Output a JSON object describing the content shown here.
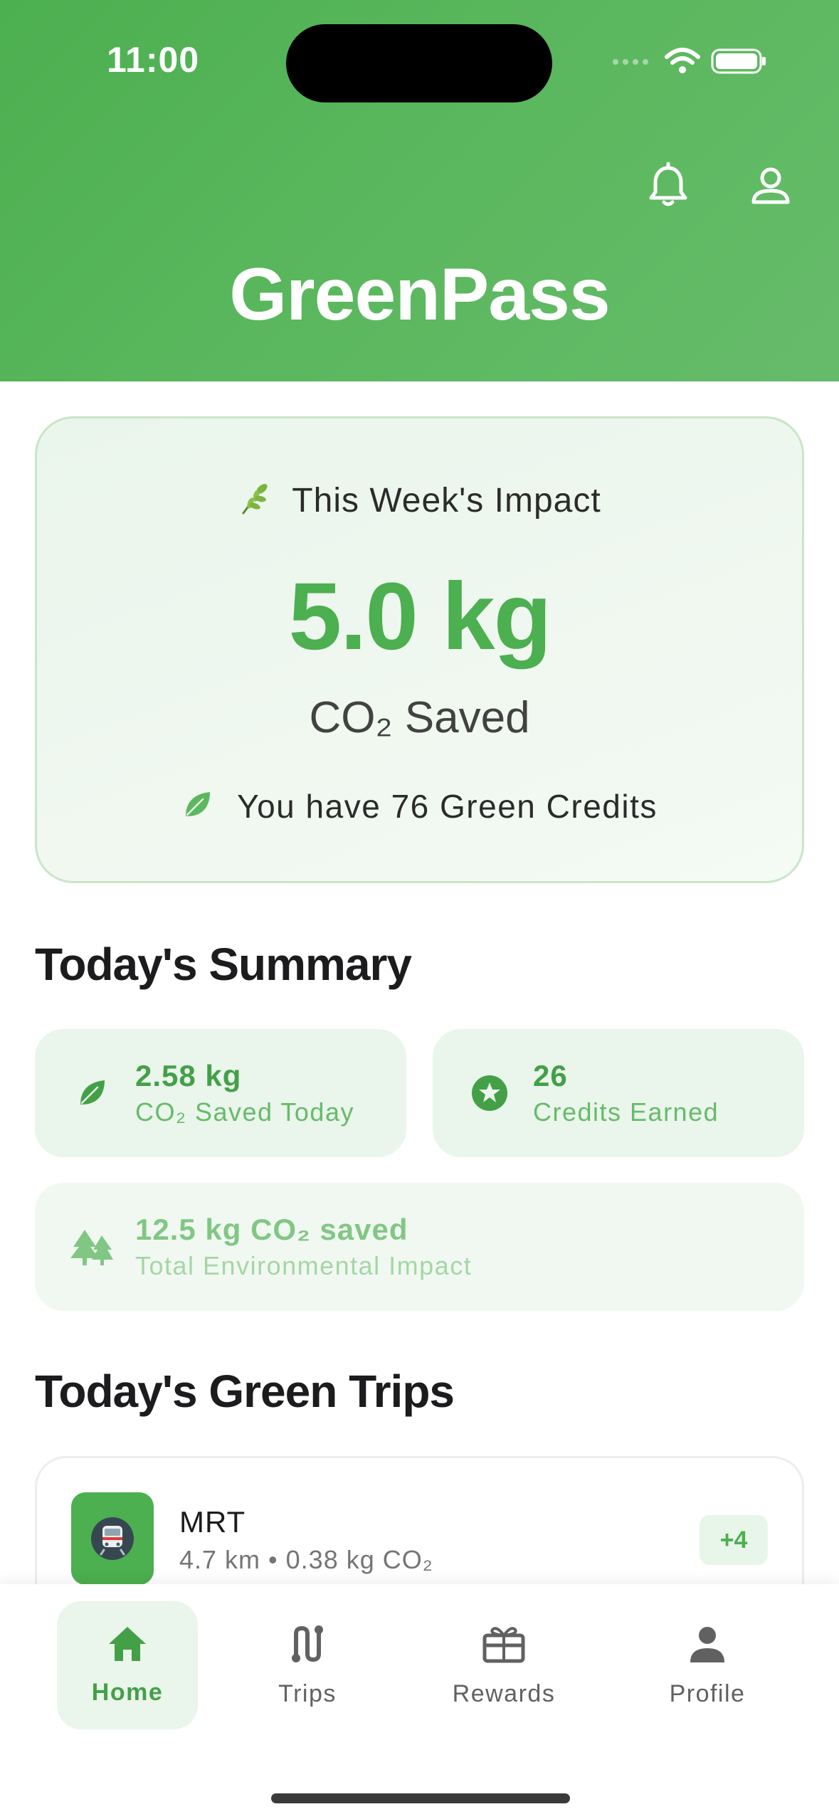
{
  "status_bar": {
    "time": "11:00"
  },
  "header": {
    "title": "GreenPass"
  },
  "impact_card": {
    "heading": "This Week's Impact",
    "value": "5.0 kg",
    "unit": "CO₂ Saved",
    "credits_text": "You have 76 Green Credits"
  },
  "today_summary": {
    "title": "Today's Summary",
    "co2_card": {
      "value": "2.58 kg",
      "label": "CO₂ Saved Today"
    },
    "credits_card": {
      "value": "26",
      "label": "Credits Earned"
    },
    "total_card": {
      "value": "12.5 kg CO₂ saved",
      "label": "Total Environmental Impact"
    }
  },
  "green_trips": {
    "title": "Today's Green Trips",
    "trips": [
      {
        "mode": "MRT",
        "details": "4.7 km • 0.38 kg CO₂",
        "credits": "+4"
      }
    ]
  },
  "bottom_nav": {
    "items": [
      {
        "label": "Home",
        "icon": "home-icon",
        "active": true
      },
      {
        "label": "Trips",
        "icon": "route-icon",
        "active": false
      },
      {
        "label": "Rewards",
        "icon": "gift-icon",
        "active": false
      },
      {
        "label": "Profile",
        "icon": "person-icon",
        "active": false
      }
    ]
  },
  "colors": {
    "primary": "#4caf50",
    "card_tint": "#eaf5eb",
    "text_dark": "#1c1c1e"
  }
}
